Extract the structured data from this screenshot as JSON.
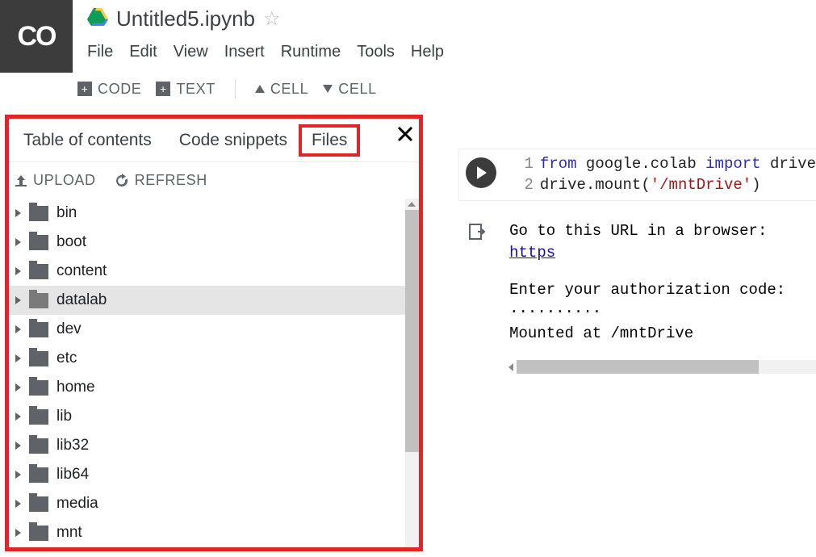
{
  "logo": "CO",
  "title": "Untitled5.ipynb",
  "menu": [
    "File",
    "Edit",
    "View",
    "Insert",
    "Runtime",
    "Tools",
    "Help"
  ],
  "toolbar": {
    "code": "CODE",
    "text": "TEXT",
    "cell_up": "CELL",
    "cell_down": "CELL"
  },
  "sidebar": {
    "tabs": [
      "Table of contents",
      "Code snippets",
      "Files"
    ],
    "active_tab": 2,
    "actions": {
      "upload": "UPLOAD",
      "refresh": "REFRESH"
    },
    "files": [
      {
        "name": "bin",
        "sel": false
      },
      {
        "name": "boot",
        "sel": false
      },
      {
        "name": "content",
        "sel": false
      },
      {
        "name": "datalab",
        "sel": true
      },
      {
        "name": "dev",
        "sel": false
      },
      {
        "name": "etc",
        "sel": false
      },
      {
        "name": "home",
        "sel": false
      },
      {
        "name": "lib",
        "sel": false
      },
      {
        "name": "lib32",
        "sel": false
      },
      {
        "name": "lib64",
        "sel": false
      },
      {
        "name": "media",
        "sel": false
      },
      {
        "name": "mnt",
        "sel": false
      }
    ]
  },
  "code": {
    "line1_kw1": "from",
    "line1_mod": " google.colab ",
    "line1_kw2": "import",
    "line1_imp": " drive",
    "line2_pre": "drive.mount(",
    "line2_str": "'/mntDrive'",
    "line2_post": ")"
  },
  "output": {
    "l1a": "Go to this URL in a browser: ",
    "l1b": "https",
    "l2": "Enter your authorization code:",
    "l3": "··········",
    "l4": "Mounted at /mntDrive"
  }
}
